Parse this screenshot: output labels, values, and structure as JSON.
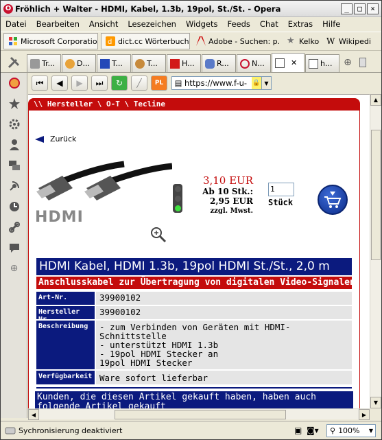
{
  "window": {
    "title": "Fröhlich + Walter - HDMI, Kabel, 1.3b, 19pol, St./St. - Opera",
    "app_icon": "O"
  },
  "menu": [
    "Datei",
    "Bearbeiten",
    "Ansicht",
    "Lesezeichen",
    "Widgets",
    "Feeds",
    "Chat",
    "Extras",
    "Hilfe"
  ],
  "bookmarks": [
    {
      "label": "Microsoft Corporation",
      "icon": "windows-icon"
    },
    {
      "label": "dict.cc Wörterbuch : ...",
      "icon": "dict-icon"
    },
    {
      "label": "Adobe - Suchen: p...",
      "icon": "adobe-icon"
    },
    {
      "label": "Kelkoo",
      "icon": "star-icon"
    },
    {
      "label": "Wikipedia",
      "icon": "wikipedia-icon"
    }
  ],
  "tabs": [
    {
      "label": "Tr...",
      "icon": "tools-icon"
    },
    {
      "label": "D...",
      "icon": "people-icon"
    },
    {
      "label": "T...",
      "icon": "screen-icon"
    },
    {
      "label": "T...",
      "icon": "monkey-icon"
    },
    {
      "label": "H...",
      "icon": "red-icon"
    },
    {
      "label": "R...",
      "icon": "blue-icon"
    },
    {
      "label": "N...",
      "icon": "opera-icon"
    },
    {
      "label": "",
      "icon": "page-icon",
      "active": true
    },
    {
      "label": "h...",
      "icon": "page-icon"
    }
  ],
  "navbar": {
    "url": "https://www.f-u-"
  },
  "page": {
    "breadcrumb": "\\\\ Hersteller \\ O-T \\ Tecline",
    "back_label": "Zurück",
    "price": "3,10 EUR",
    "bulk_label": "Ab 10 Stk.:",
    "bulk_price": "2,95 EUR",
    "tax_note": "zzgl. Mwst.",
    "quantity": "1",
    "quantity_label": "Stück",
    "product_title": "HDMI Kabel, HDMI 1.3b, 19pol HDMI St./St., 2,0 m",
    "product_subtitle": "Anschlusskabel zur Übertragung von digitalen Video-Signalen",
    "specs": {
      "art_label": "Art-Nr.",
      "art_value": "39900102",
      "mfr_label": "Hersteller Nr.",
      "mfr_value": "39900102",
      "desc_label": "Beschreibung",
      "desc_lines": [
        "- zum Verbinden von Geräten mit HDMI-",
        "Schnittstelle",
        "- unterstützt HDMI 1.3b",
        "- 19pol HDMI Stecker an",
        "19pol HDMI Stecker"
      ],
      "avail_label": "Verfügbarkeit",
      "avail_value": "Ware sofort lieferbar"
    },
    "related": "Kunden, die diesen Artikel gekauft haben, haben auch folgende Artikel gekauft",
    "hdmi_logo": "HDMI"
  },
  "status": {
    "text": "Sychronisierung deaktiviert",
    "zoom": "100%"
  },
  "colors": {
    "red": "#c40c0c",
    "navy": "#0b1a7e"
  }
}
